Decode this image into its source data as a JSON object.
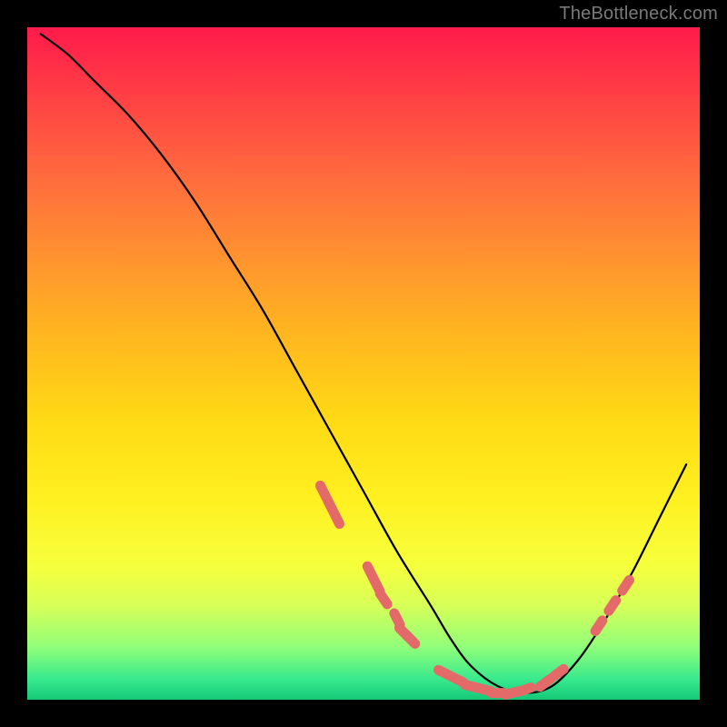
{
  "watermark": "TheBottleneck.com",
  "chart_data": {
    "type": "line",
    "title": "",
    "xlabel": "",
    "ylabel": "",
    "xlim": [
      0,
      100
    ],
    "ylim": [
      0,
      100
    ],
    "note": "Axes are unlabeled in the image; values are estimated percentages of the plot area.",
    "series": [
      {
        "name": "bottleneck-curve",
        "x": [
          2,
          6,
          10,
          15,
          20,
          25,
          30,
          35,
          40,
          45,
          50,
          55,
          60,
          63,
          66,
          70,
          74,
          78,
          82,
          86,
          90,
          94,
          98
        ],
        "y": [
          99,
          96,
          92,
          87,
          81,
          74,
          66,
          58,
          49,
          40,
          31,
          22,
          14,
          9,
          5,
          2,
          1,
          2,
          6,
          12,
          19,
          27,
          35
        ]
      }
    ],
    "highlight_clusters": [
      {
        "name": "left-shoulder",
        "points": [
          {
            "x": 44,
            "y": 31
          },
          {
            "x": 45,
            "y": 29
          },
          {
            "x": 46,
            "y": 27
          }
        ]
      },
      {
        "name": "descent",
        "points": [
          {
            "x": 51,
            "y": 19
          },
          {
            "x": 52,
            "y": 17
          },
          {
            "x": 53,
            "y": 15
          },
          {
            "x": 55,
            "y": 12
          },
          {
            "x": 56,
            "y": 10
          },
          {
            "x": 57,
            "y": 9
          }
        ]
      },
      {
        "name": "valley-floor",
        "points": [
          {
            "x": 62,
            "y": 4
          },
          {
            "x": 64,
            "y": 3
          },
          {
            "x": 66,
            "y": 2
          },
          {
            "x": 68,
            "y": 1.5
          },
          {
            "x": 70,
            "y": 1
          },
          {
            "x": 72,
            "y": 1
          },
          {
            "x": 74,
            "y": 1.5
          },
          {
            "x": 77,
            "y": 2.5
          },
          {
            "x": 79,
            "y": 4
          }
        ]
      },
      {
        "name": "ascent",
        "points": [
          {
            "x": 85,
            "y": 11
          },
          {
            "x": 87,
            "y": 14
          },
          {
            "x": 89,
            "y": 17
          }
        ]
      }
    ],
    "colors": {
      "curve": "#000000",
      "highlight": "#e46a6a",
      "gradient_top": "#ff1a4b",
      "gradient_bottom": "#14c877"
    }
  }
}
